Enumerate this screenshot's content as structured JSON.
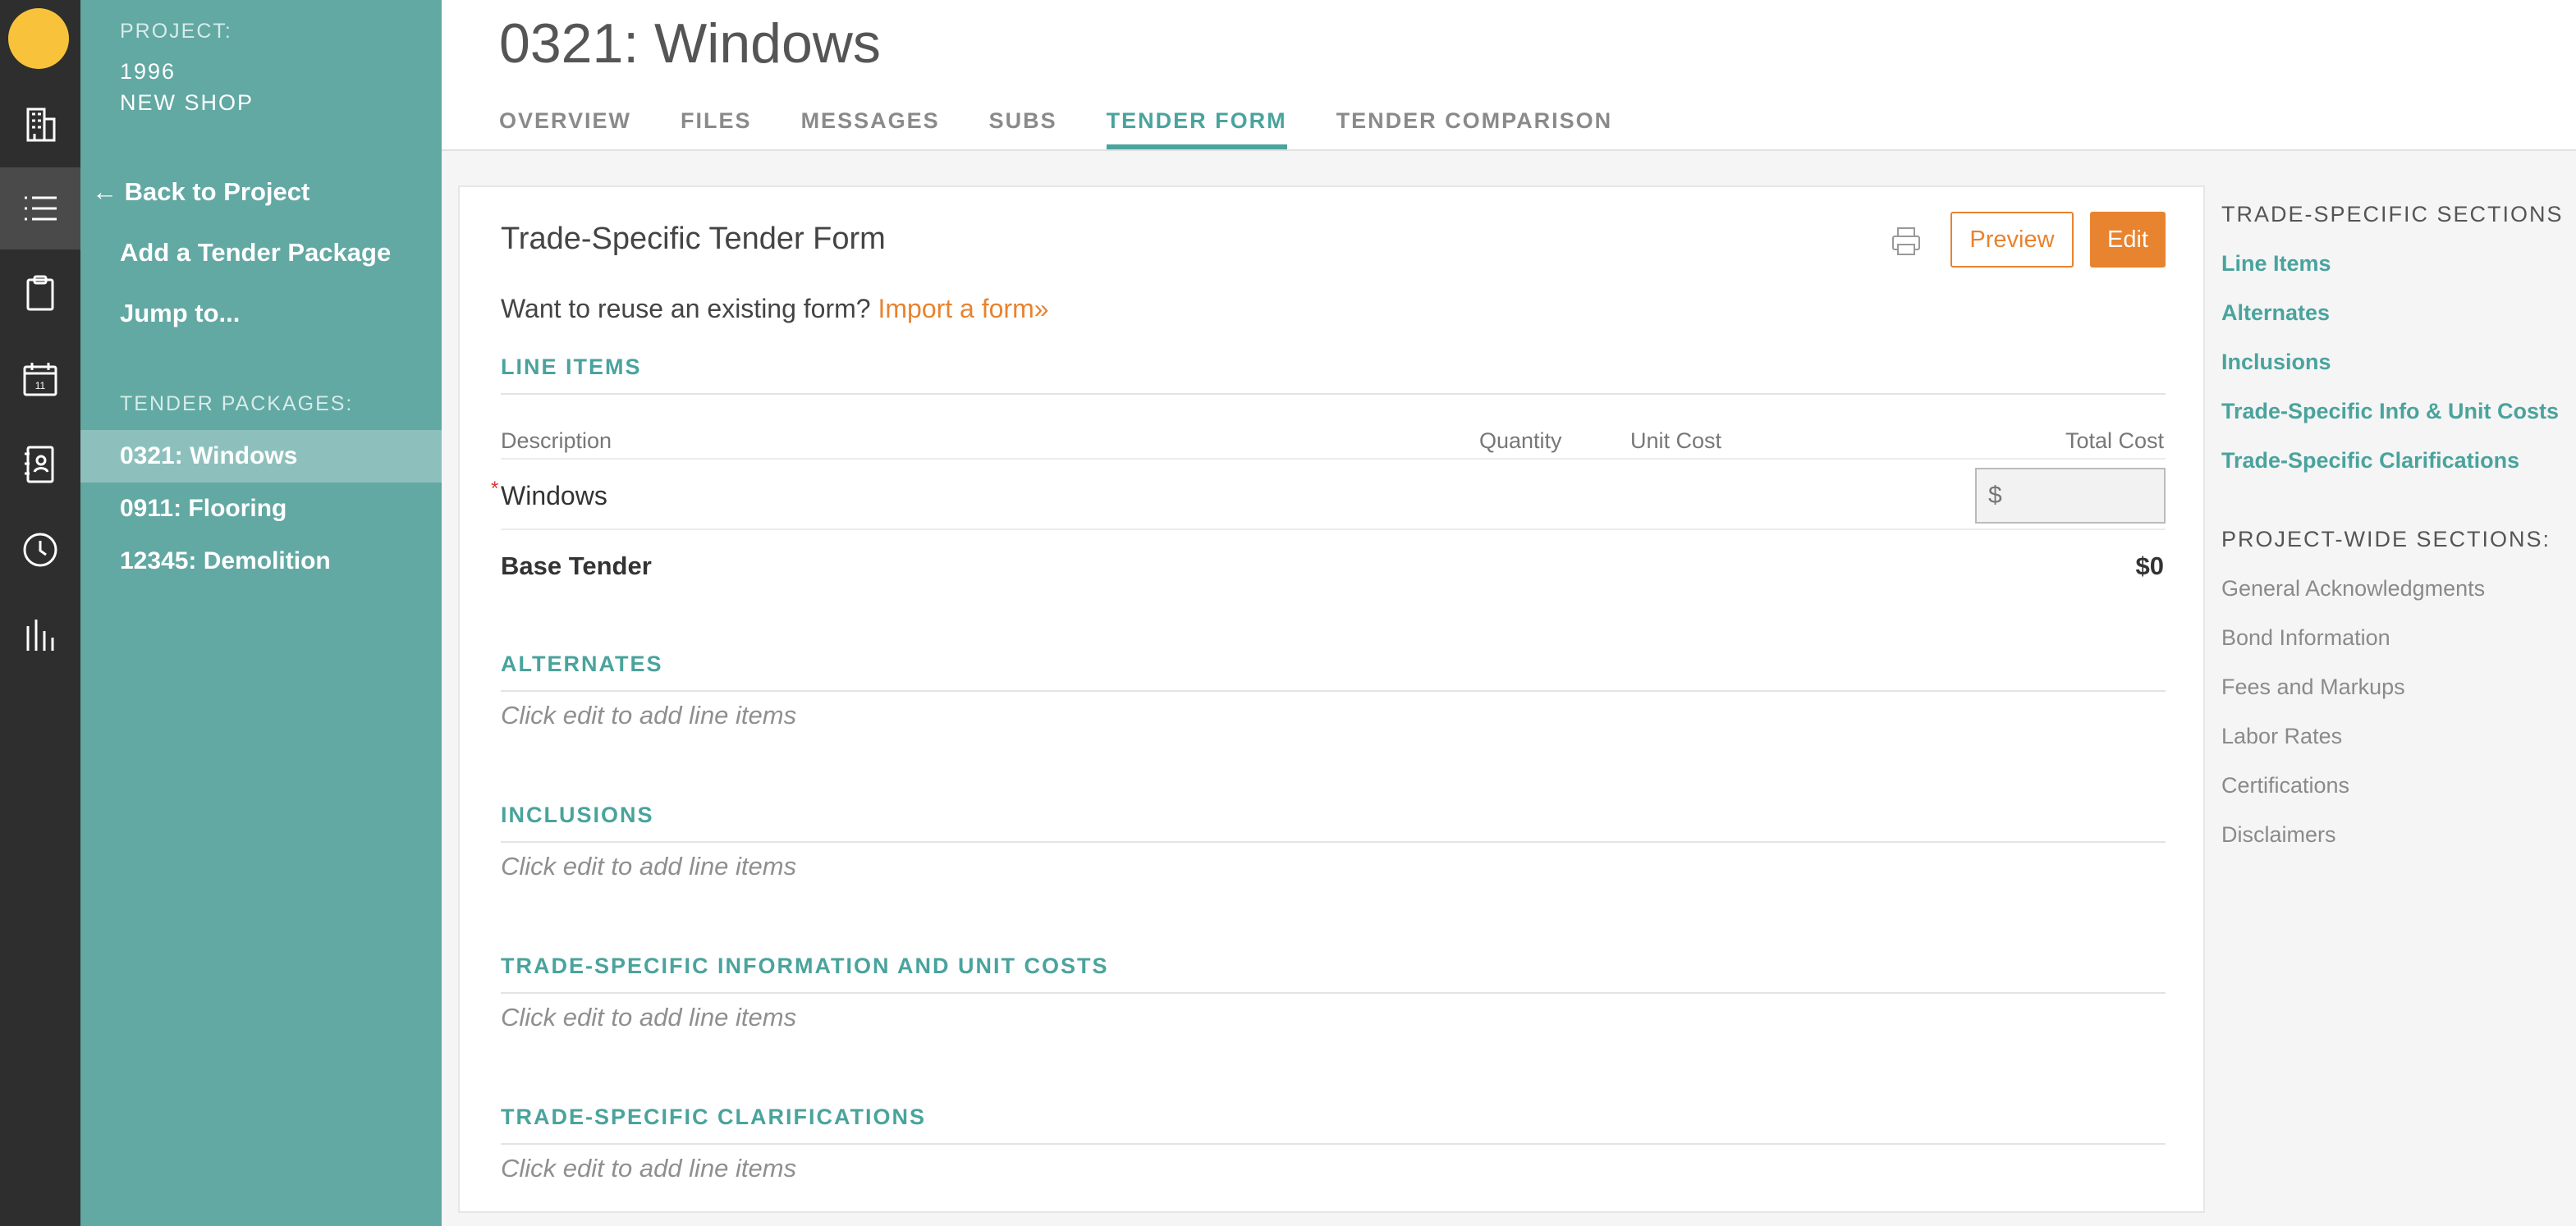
{
  "sidebar": {
    "project_label": "PROJECT:",
    "project_name": "1996\nNEW SHOP",
    "back_label": "Back to Project",
    "add_label": "Add a Tender Package",
    "jump_label": "Jump to...",
    "packages_label": "TENDER PACKAGES:",
    "packages": [
      {
        "label": "0321: Windows"
      },
      {
        "label": "0911: Flooring"
      },
      {
        "label": "12345: Demolition"
      }
    ]
  },
  "rail_icons": [
    "building-icon",
    "list-icon",
    "clipboard-icon",
    "calendar-icon",
    "contacts-icon",
    "clock-icon",
    "chart-icon"
  ],
  "header": {
    "title": "0321: Windows",
    "tabs": [
      {
        "label": "OVERVIEW"
      },
      {
        "label": "FILES"
      },
      {
        "label": "MESSAGES"
      },
      {
        "label": "SUBS"
      },
      {
        "label": "TENDER FORM"
      },
      {
        "label": "TENDER COMPARISON"
      }
    ],
    "active_tab": "TENDER FORM"
  },
  "form": {
    "title": "Trade-Specific Tender Form",
    "preview_label": "Preview",
    "edit_label": "Edit",
    "reuse_text": "Want to reuse an existing form?",
    "import_link": "Import a form»",
    "line_items_heading": "LINE ITEMS",
    "columns": {
      "description": "Description",
      "quantity": "Quantity",
      "unit_cost": "Unit Cost",
      "total_cost": "Total Cost"
    },
    "rows": [
      {
        "description": "Windows",
        "required_mark": "*",
        "total_placeholder": "$"
      }
    ],
    "base_label": "Base Tender",
    "base_value": "$0",
    "sections": [
      {
        "heading": "ALTERNATES",
        "empty": "Click edit to add line items"
      },
      {
        "heading": "INCLUSIONS",
        "empty": "Click edit to add line items"
      },
      {
        "heading": "TRADE-SPECIFIC INFORMATION AND UNIT COSTS",
        "empty": "Click edit to add line items"
      },
      {
        "heading": "TRADE-SPECIFIC CLARIFICATIONS",
        "empty": "Click edit to add line items"
      }
    ]
  },
  "right_nav": {
    "trade_heading": "TRADE-SPECIFIC SECTIONS",
    "trade_links": [
      "Line Items",
      "Alternates",
      "Inclusions",
      "Trade-Specific Info & Unit Costs",
      "Trade-Specific Clarifications"
    ],
    "project_heading": "PROJECT-WIDE SECTIONS:",
    "project_links": [
      "General Acknowledgments",
      "Bond Information",
      "Fees and Markups",
      "Labor Rates",
      "Certifications",
      "Disclaimers"
    ]
  },
  "colors": {
    "teal": "#62a8a3",
    "accent_teal": "#4aa39d",
    "orange": "#e8832f",
    "rail": "#2e2e2e",
    "avatar": "#f8c33a"
  }
}
